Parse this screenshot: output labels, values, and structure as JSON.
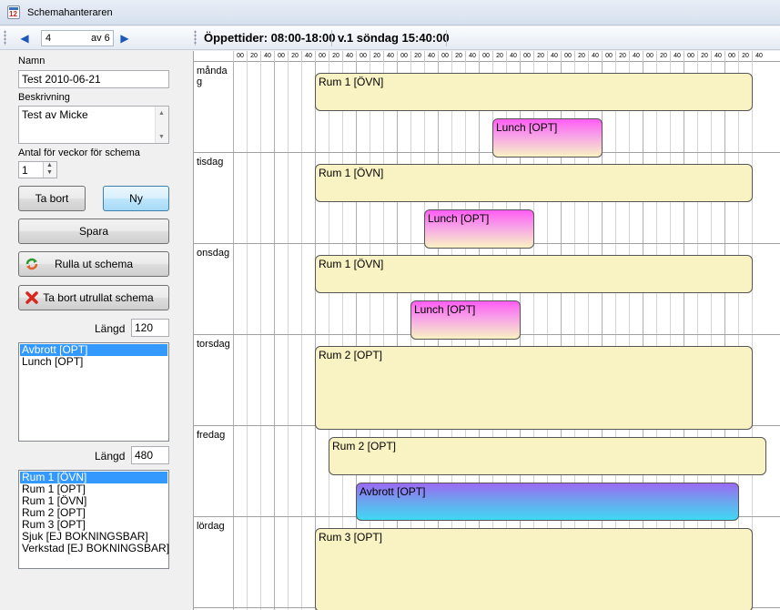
{
  "window": {
    "title": "Schemahanteraren"
  },
  "toolbar": {
    "record_value": "4",
    "record_count": "av 6",
    "opening_hours": "Öppettider: 08:00-18:00",
    "week_time": "v.1 söndag 15:40:00"
  },
  "form": {
    "name_label": "Namn",
    "name_value": "Test 2010-06-21",
    "description_label": "Beskrivning",
    "description_value": "Test av Micke",
    "weeks_label": "Antal för veckor för schema",
    "weeks_value": "1",
    "delete_label": "Ta bort",
    "new_label": "Ny",
    "save_label": "Spara",
    "rollout_label": "Rulla ut schema",
    "remove_rollout_label": "Ta bort utrullat schema",
    "length_label_1": "Längd",
    "length_value_1": "120",
    "length_label_2": "Längd",
    "length_value_2": "480"
  },
  "break_list": {
    "items": [
      "Avbrott [OPT]",
      "Lunch [OPT]"
    ],
    "selected": 0
  },
  "activity_list": {
    "items": [
      "Rum 1  [ÖVN]",
      "Rum 1 [OPT]",
      "Rum 1 [ÖVN]",
      "Rum 2 [OPT]",
      "Rum 3 [OPT]",
      "Sjuk [EJ BOKNINGSBAR]",
      "Verkstad [EJ BOKNINGSBAR]"
    ],
    "selected": 0
  },
  "schedule": {
    "tick_labels": [
      "00",
      "20",
      "40",
      "00",
      "20",
      "40",
      "00",
      "20",
      "40",
      "00",
      "20",
      "40",
      "00",
      "20",
      "40",
      "00",
      "20",
      "40",
      "00",
      "20",
      "40",
      "00",
      "20",
      "40",
      "00",
      "20",
      "40",
      "00",
      "20",
      "40",
      "00",
      "20",
      "40",
      "00",
      "20",
      "40",
      "00",
      "20",
      "40"
    ],
    "days": [
      {
        "name": "måndag",
        "blocks": [
          {
            "label": "Rum 1  [ÖVN]",
            "color": "yellow"
          },
          {
            "label": "Lunch [OPT]",
            "color": "pink"
          }
        ]
      },
      {
        "name": "tisdag",
        "blocks": [
          {
            "label": "Rum 1  [ÖVN]",
            "color": "yellow"
          },
          {
            "label": "Lunch [OPT]",
            "color": "pink"
          }
        ]
      },
      {
        "name": "onsdag",
        "blocks": [
          {
            "label": "Rum 1  [ÖVN]",
            "color": "yellow"
          },
          {
            "label": "Lunch [OPT]",
            "color": "pink"
          }
        ]
      },
      {
        "name": "torsdag",
        "blocks": [
          {
            "label": "Rum 2 [OPT]",
            "color": "yellow"
          }
        ]
      },
      {
        "name": "fredag",
        "blocks": [
          {
            "label": "Rum 2 [OPT]",
            "color": "yellow"
          },
          {
            "label": "Avbrott [OPT]",
            "color": "blue"
          }
        ]
      },
      {
        "name": "lördag",
        "blocks": [
          {
            "label": "Rum 3 [OPT]",
            "color": "yellow"
          }
        ]
      }
    ]
  }
}
